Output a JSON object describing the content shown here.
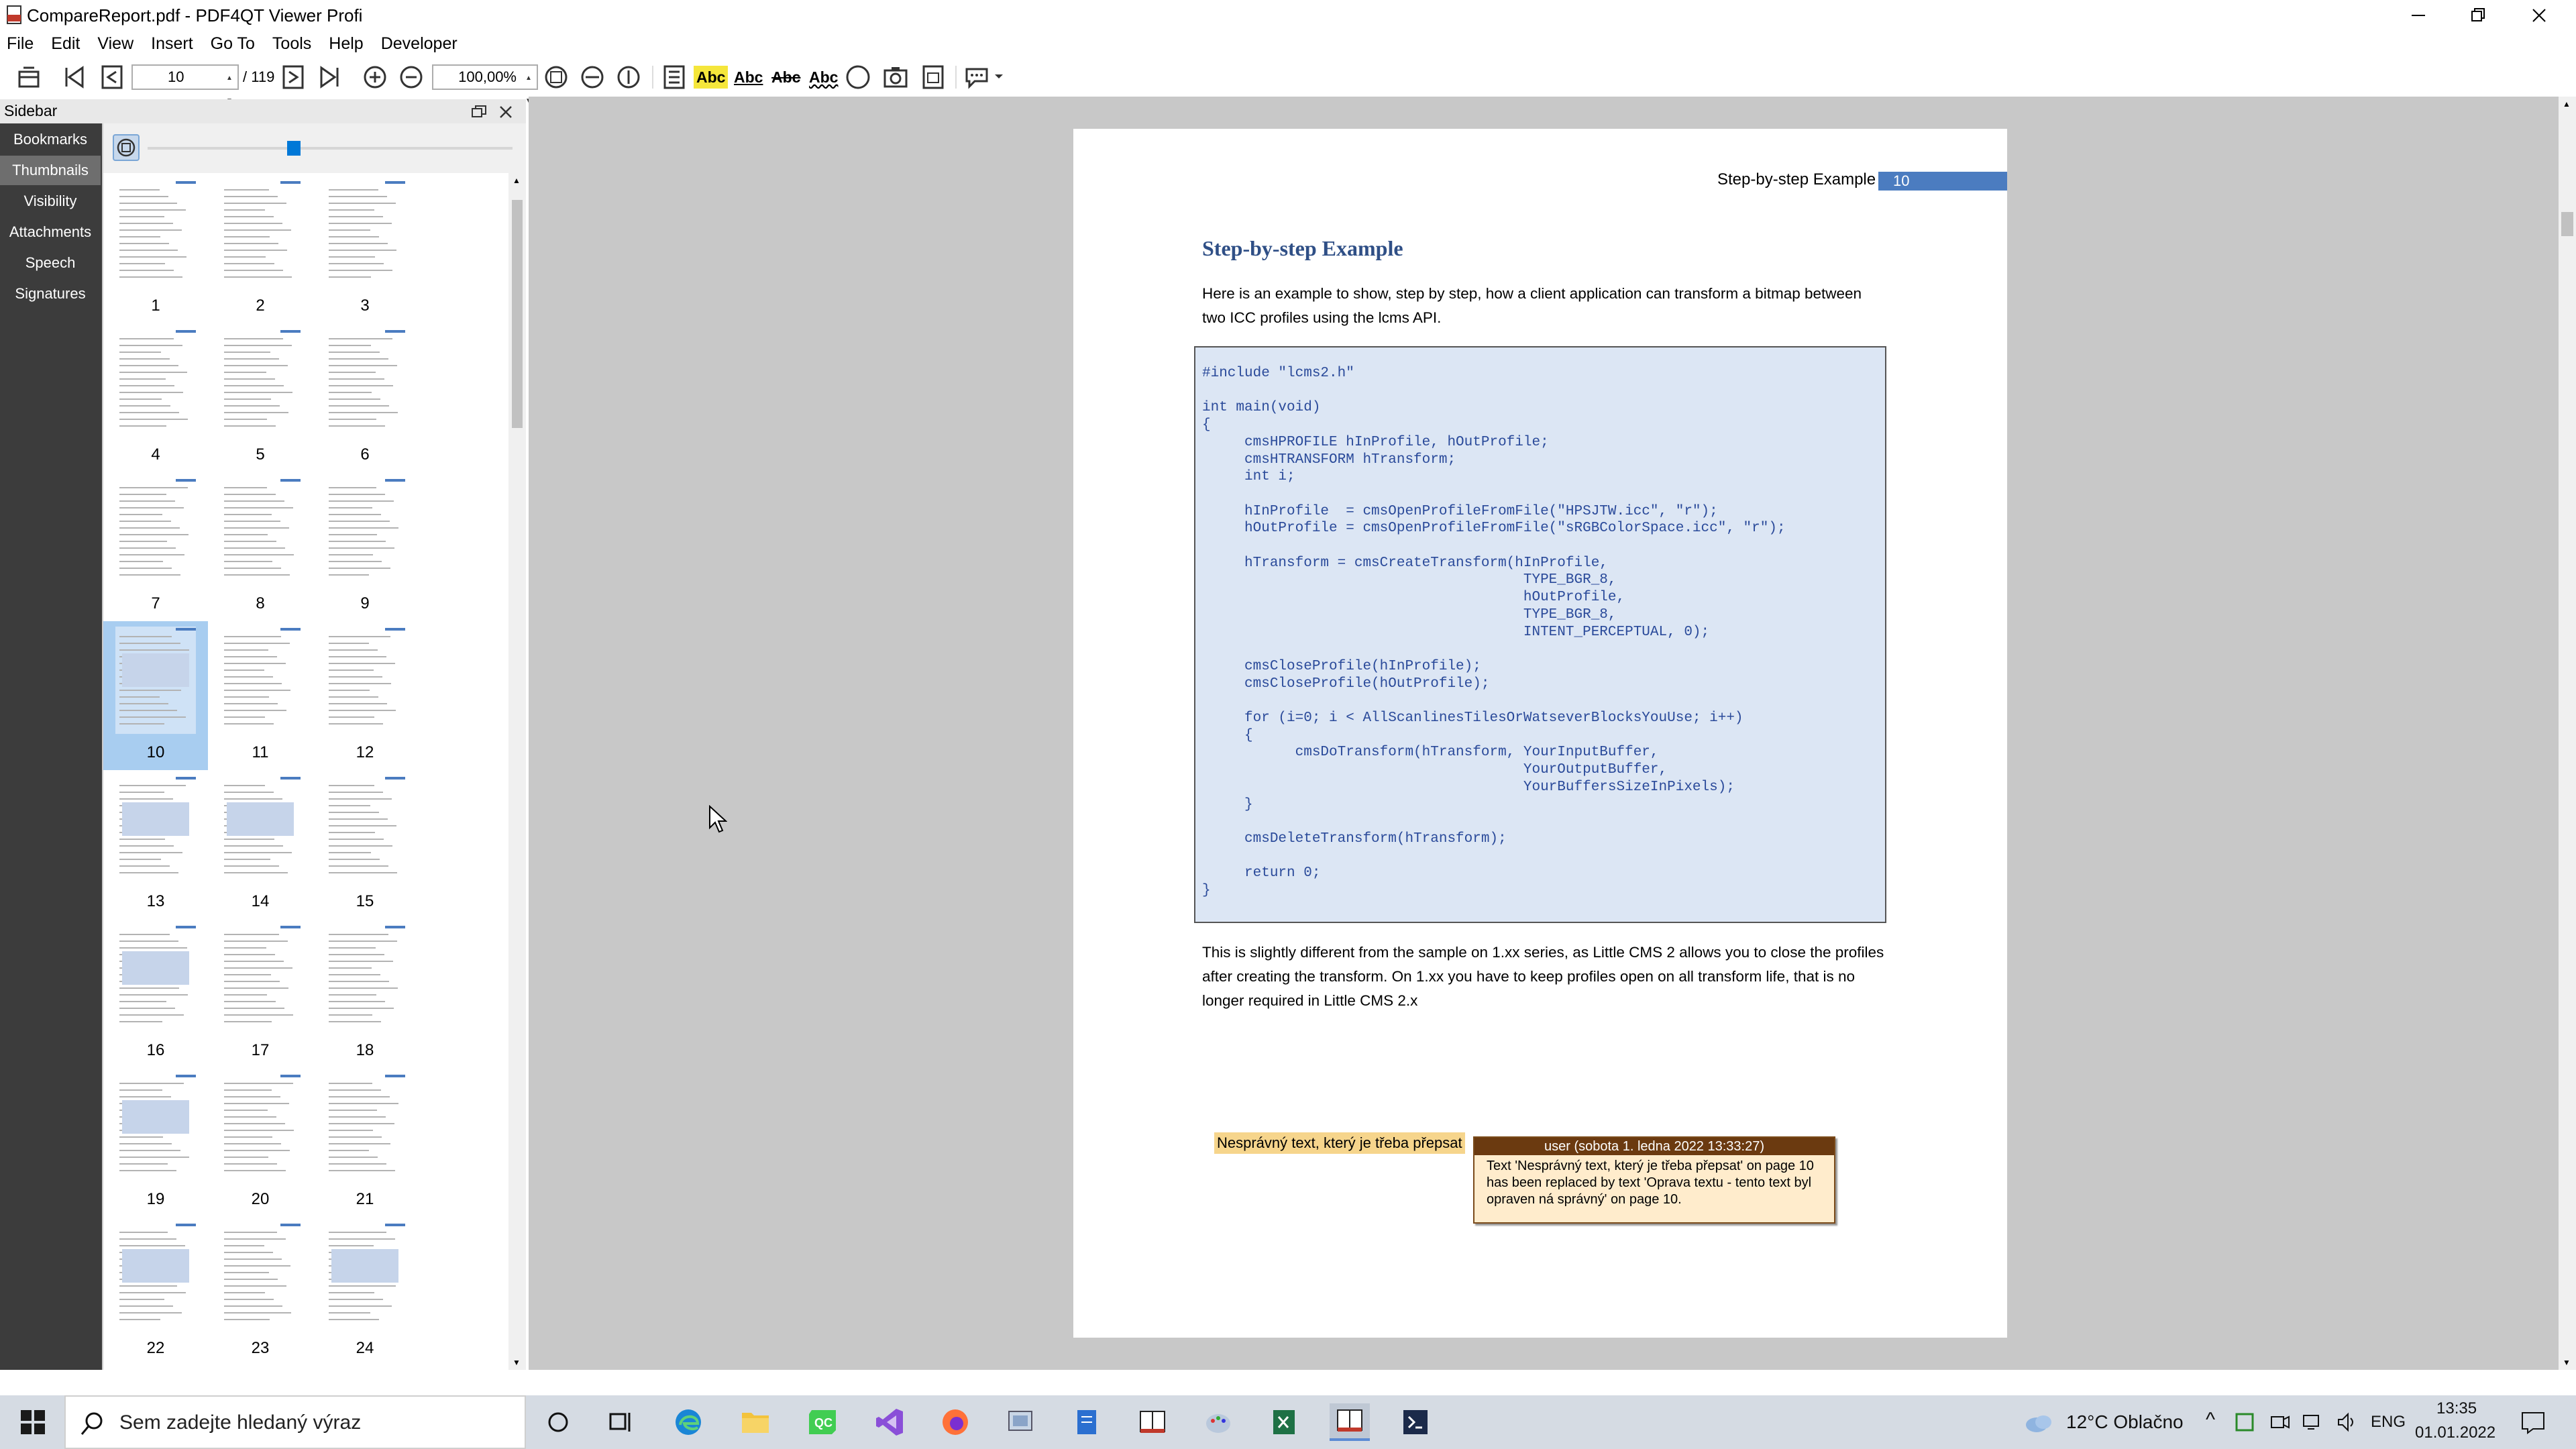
{
  "window": {
    "title": "CompareReport.pdf - PDF4QT Viewer Profi"
  },
  "menu": {
    "items": [
      "File",
      "Edit",
      "View",
      "Insert",
      "Go To",
      "Tools",
      "Help",
      "Developer"
    ]
  },
  "toolbar": {
    "page_value": "10",
    "page_total": "/ 119",
    "zoom_value": "100,00%",
    "abc_label": "Abc"
  },
  "sidebar": {
    "title": "Sidebar",
    "tabs": [
      "Bookmarks",
      "Thumbnails",
      "Visibility",
      "Attachments",
      "Speech",
      "Signatures"
    ],
    "active_tab": "Thumbnails",
    "selected_thumbnail": "10",
    "thumbnails": [
      "1",
      "2",
      "3",
      "4",
      "5",
      "6",
      "7",
      "8",
      "9",
      "10",
      "11",
      "12",
      "13",
      "14",
      "15",
      "16",
      "17",
      "18",
      "19",
      "20",
      "21",
      "22",
      "23",
      "24"
    ]
  },
  "page": {
    "header_title": "Step-by-step Example",
    "header_page_number": "10",
    "heading": "Step-by-step Example",
    "intro": "Here is an example to show, step by step, how a client application can transform a bitmap between two ICC profiles using the lcms API.",
    "code": "#include \"lcms2.h\"\n\nint main(void)\n{\n     cmsHPROFILE hInProfile, hOutProfile;\n     cmsHTRANSFORM hTransform;\n     int i;\n\n     hInProfile  = cmsOpenProfileFromFile(\"HPSJTW.icc\", \"r\");\n     hOutProfile = cmsOpenProfileFromFile(\"sRGBColorSpace.icc\", \"r\");\n\n     hTransform = cmsCreateTransform(hInProfile,\n                                      TYPE_BGR_8,\n                                      hOutProfile,\n                                      TYPE_BGR_8,\n                                      INTENT_PERCEPTUAL, 0);\n\n     cmsCloseProfile(hInProfile);\n     cmsCloseProfile(hOutProfile);\n\n     for (i=0; i < AllScanlinesTilesOrWatseverBlocksYouUse; i++)\n     {\n           cmsDoTransform(hTransform, YourInputBuffer,\n                                      YourOutputBuffer,\n                                      YourBuffersSizeInPixels);\n     }\n\n     cmsDeleteTransform(hTransform);\n\n     return 0;\n}",
    "after_code": "This is slightly different from the sample on 1.xx series, as Little CMS 2 allows you to close the profiles after creating the transform. On 1.xx you have to keep profiles open on all transform life, that is no longer required in Little CMS 2.x",
    "highlighted_text": "Nesprávný text, který je třeba přepsat"
  },
  "annotation": {
    "author": "user (sobota 1. ledna 2022 13:33:27)",
    "text": "Text 'Nesprávný text, který je třeba přepsat' on page 10 has been replaced by text 'Oprava textu - tento text byl opraven ná správný' on page 10."
  },
  "taskbar": {
    "search_placeholder": "Sem zadejte hledaný výraz",
    "weather": "12°C  Oblačno",
    "language": "ENG",
    "time": "13:35",
    "date": "01.01.2022"
  },
  "colors": {
    "accent": "#4b7cc0",
    "code_background": "#dce6f4",
    "highlight": "#f6d58c",
    "popup_header": "#6b3a10",
    "sidebar_tabs": "#3c3c3c"
  }
}
